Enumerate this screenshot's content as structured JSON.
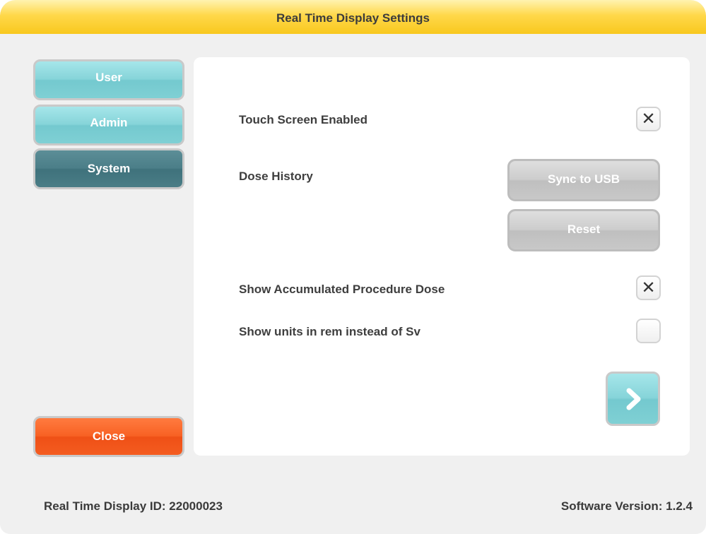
{
  "window": {
    "title": "Real Time Display Settings"
  },
  "nav": {
    "user_label": "User",
    "admin_label": "Admin",
    "system_label": "System",
    "close_label": "Close",
    "selected": "System"
  },
  "settings": {
    "touch_screen": {
      "label": "Touch Screen Enabled",
      "checked": true
    },
    "dose_history": {
      "label": "Dose History",
      "sync_label": "Sync to USB",
      "reset_label": "Reset"
    },
    "accumulated_dose": {
      "label": "Show Accumulated Procedure Dose",
      "checked": true
    },
    "units_rem": {
      "label": "Show units in rem instead of Sv",
      "checked": false
    }
  },
  "icons": {
    "next": "chevron-right-icon",
    "check": "x-mark-icon"
  },
  "footer": {
    "display_id": "Real Time Display ID: 22000023",
    "software_version": "Software Version: 1.2.4"
  },
  "colors": {
    "title_bar": "#f8c81e",
    "nav_teal": "#86d4d9",
    "nav_selected": "#4b7e88",
    "close": "#f86224",
    "gray_button": "#c8c8c8"
  }
}
